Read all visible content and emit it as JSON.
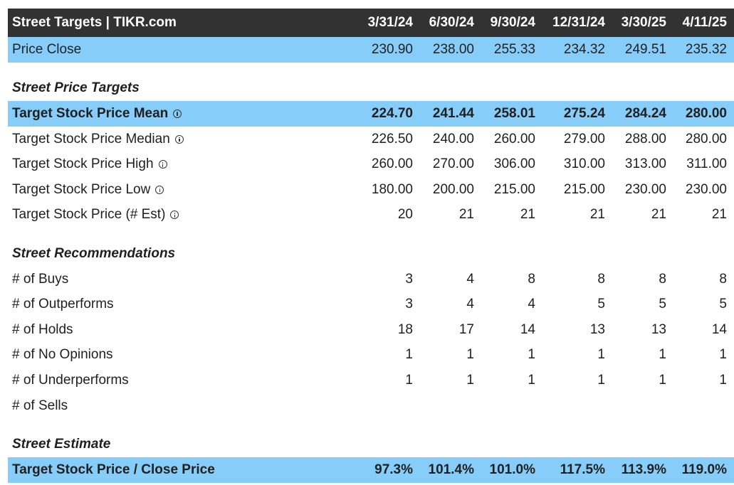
{
  "header": {
    "title": "Street Targets | TIKR.com",
    "dates": [
      "3/31/24",
      "6/30/24",
      "9/30/24",
      "12/31/24",
      "3/30/25",
      "4/11/25"
    ]
  },
  "price_close": {
    "label": "Price Close",
    "values": [
      "230.90",
      "238.00",
      "255.33",
      "234.32",
      "249.51",
      "235.32"
    ]
  },
  "price_targets": {
    "section_title": "Street Price Targets",
    "rows": [
      {
        "label": "Target Stock Price Mean",
        "values": [
          "224.70",
          "241.44",
          "258.01",
          "275.24",
          "284.24",
          "280.00"
        ]
      },
      {
        "label": "Target Stock Price Median",
        "values": [
          "226.50",
          "240.00",
          "260.00",
          "279.00",
          "288.00",
          "280.00"
        ]
      },
      {
        "label": "Target Stock Price High",
        "values": [
          "260.00",
          "270.00",
          "306.00",
          "310.00",
          "313.00",
          "311.00"
        ]
      },
      {
        "label": "Target Stock Price Low",
        "values": [
          "180.00",
          "200.00",
          "215.00",
          "215.00",
          "230.00",
          "230.00"
        ]
      },
      {
        "label": "Target Stock Price (# Est)",
        "values": [
          "20",
          "21",
          "21",
          "21",
          "21",
          "21"
        ]
      }
    ]
  },
  "recommendations": {
    "section_title": "Street Recommendations",
    "rows": [
      {
        "label": "# of Buys",
        "values": [
          "3",
          "4",
          "8",
          "8",
          "8",
          "8"
        ]
      },
      {
        "label": "# of Outperforms",
        "values": [
          "3",
          "4",
          "4",
          "5",
          "5",
          "5"
        ]
      },
      {
        "label": "# of Holds",
        "values": [
          "18",
          "17",
          "14",
          "13",
          "13",
          "14"
        ]
      },
      {
        "label": "# of No Opinions",
        "values": [
          "1",
          "1",
          "1",
          "1",
          "1",
          "1"
        ]
      },
      {
        "label": "# of Underperforms",
        "values": [
          "1",
          "1",
          "1",
          "1",
          "1",
          "1"
        ]
      },
      {
        "label": "# of Sells",
        "values": [
          "",
          "",
          "",
          "",
          "",
          ""
        ]
      }
    ]
  },
  "estimate": {
    "section_title": "Street Estimate",
    "rows": [
      {
        "label": "Target Stock Price / Close Price",
        "values": [
          "97.3%",
          "101.4%",
          "101.0%",
          "117.5%",
          "113.9%",
          "119.0%"
        ]
      }
    ]
  },
  "colors": {
    "header_bg": "#323232",
    "highlight_bg": "#87cdf9"
  },
  "icons": {
    "info": "info-circle-icon"
  }
}
